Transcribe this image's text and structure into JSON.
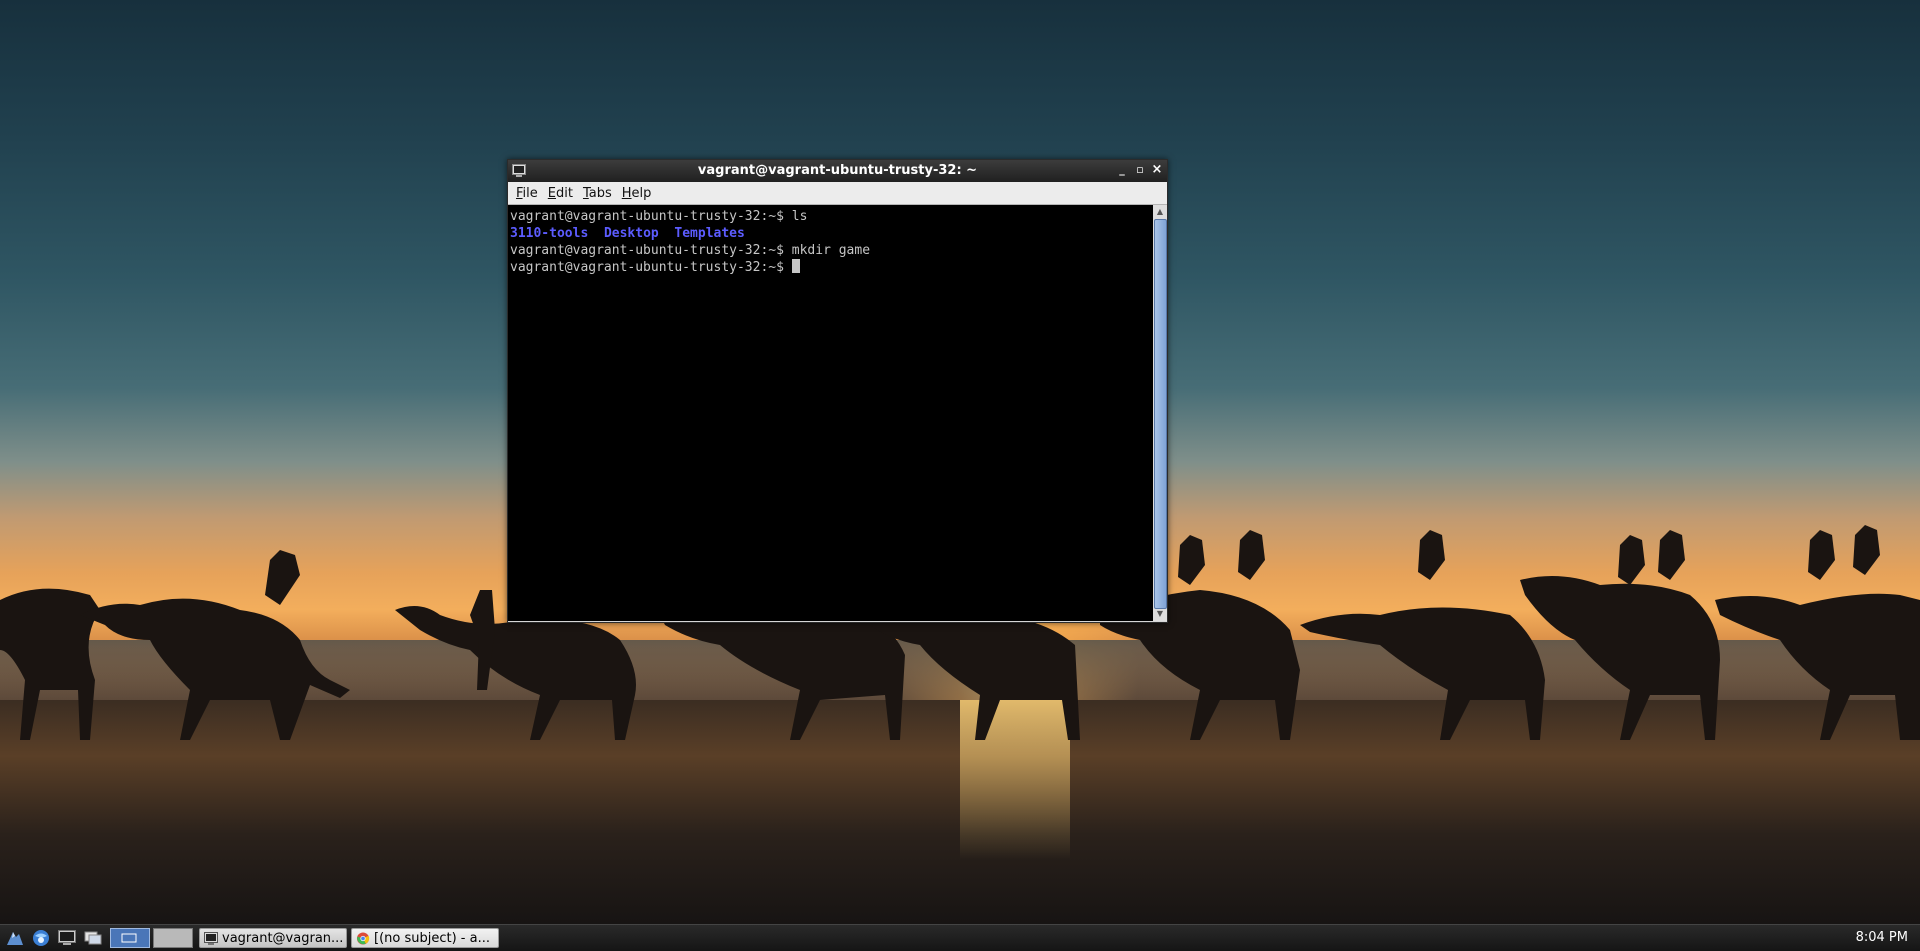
{
  "window": {
    "title": "vagrant@vagrant-ubuntu-trusty-32: ~",
    "controls": {
      "minimize": "_",
      "maximize": "▫",
      "close": "×"
    }
  },
  "menubar": [
    {
      "first": "F",
      "rest": "ile"
    },
    {
      "first": "E",
      "rest": "dit"
    },
    {
      "first": "T",
      "rest": "abs"
    },
    {
      "first": "H",
      "rest": "elp"
    }
  ],
  "terminal": {
    "prompt": "vagrant@vagrant-ubuntu-trusty-32:~$ ",
    "line1_cmd": "ls",
    "ls_output": [
      "3110-tools",
      "Desktop",
      "Templates"
    ],
    "line3_cmd": "mkdir game",
    "colors": {
      "background": "#000000",
      "text": "#c6c6c6",
      "directory": "#5c5cff"
    }
  },
  "taskbar": {
    "tasks": [
      {
        "label": "vagrant@vagran...",
        "icon": "terminal-icon"
      },
      {
        "label": "[(no subject) - a...",
        "icon": "chrome-icon"
      }
    ],
    "clock": "8:04 PM"
  }
}
